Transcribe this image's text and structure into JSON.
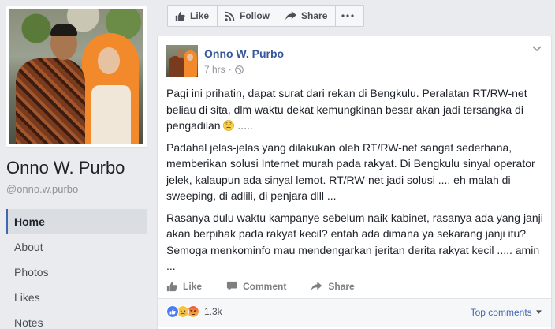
{
  "page": {
    "name": "Onno W. Purbo",
    "handle": "@onno.w.purbo"
  },
  "nav": {
    "items": [
      {
        "label": "Home",
        "active": true
      },
      {
        "label": "About",
        "active": false
      },
      {
        "label": "Photos",
        "active": false
      },
      {
        "label": "Likes",
        "active": false
      },
      {
        "label": "Notes",
        "active": false
      }
    ]
  },
  "actionbar": {
    "like_label": "Like",
    "follow_label": "Follow",
    "share_label": "Share",
    "more_icon": "ellipsis-icon"
  },
  "post": {
    "author": "Onno W. Purbo",
    "time": "7 hrs",
    "privacy_icon": "globe-icon",
    "paragraphs": {
      "p1": "Pagi ini prihatin, dapat surat dari rekan di Bengkulu. Peralatan RT/RW-net beliau di sita, dlm waktu dekat kemungkinan besar akan jadi tersangka di pengadilan",
      "p1_tail": " .....",
      "p2": "Padahal jelas-jelas yang dilakukan oleh RT/RW-net sangat sederhana, memberikan solusi Internet murah pada rakyat. Di Bengkulu sinyal operator jelek, kalaupun ada sinyal lemot. RT/RW-net jadi solusi .... eh malah di sweeping, di adlili, di penjara dlll ...",
      "p3": "Rasanya dulu waktu kampanye sebelum naik kabinet, rasanya ada yang janji akan berpihak pada rakyat kecil? entah ada dimana ya sekarang janji itu? Semoga menkominfo mau mendengarkan jeritan derita rakyat kecil ..... amin ..."
    },
    "actions": {
      "like_label": "Like",
      "comment_label": "Comment",
      "share_label": "Share"
    },
    "reactions": {
      "types": [
        "like",
        "sad",
        "angry"
      ],
      "count": "1.3k"
    },
    "comments_filter": "Top comments"
  },
  "colors": {
    "link_blue": "#365899",
    "accent": "#4267b2",
    "background": "#e9ebee"
  }
}
